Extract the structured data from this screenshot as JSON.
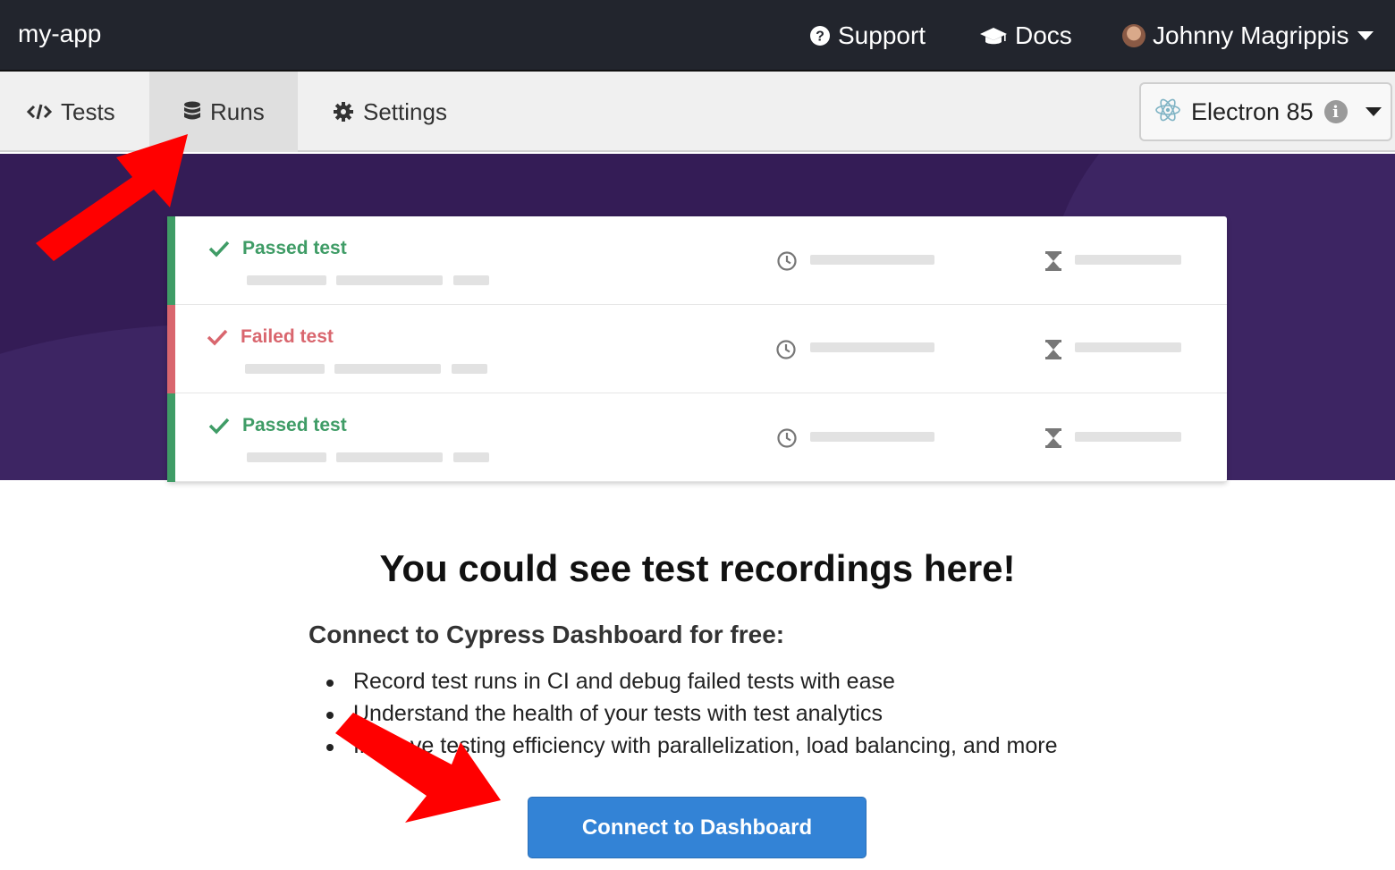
{
  "header": {
    "app_name": "my-app",
    "support_label": "Support",
    "docs_label": "Docs",
    "user_name": "Johnny Magrippis"
  },
  "tabs": [
    {
      "label": "Tests",
      "icon": "code-icon",
      "active": false
    },
    {
      "label": "Runs",
      "icon": "database-icon",
      "active": true
    },
    {
      "label": "Settings",
      "icon": "gear-icon",
      "active": false
    }
  ],
  "browser": {
    "label": "Electron 85",
    "icon": "electron-icon"
  },
  "preview_rows": [
    {
      "status": "Passed test",
      "state": "passed"
    },
    {
      "status": "Failed test",
      "state": "failed"
    },
    {
      "status": "Passed test",
      "state": "passed"
    }
  ],
  "main": {
    "headline": "You could see test recordings here!",
    "subhead": "Connect to Cypress Dashboard for free:",
    "bullets": [
      "Record test runs in CI and debug failed tests with ease",
      "Understand the health of your tests with test analytics",
      "Improve testing efficiency with parallelization, load balancing, and more"
    ],
    "cta_label": "Connect to Dashboard"
  },
  "colors": {
    "topbar": "#22252d",
    "hero": "#341c56",
    "passed": "#3f9c66",
    "failed": "#d9666e",
    "cta": "#3383d6",
    "annotation_arrow": "#ff0000"
  }
}
